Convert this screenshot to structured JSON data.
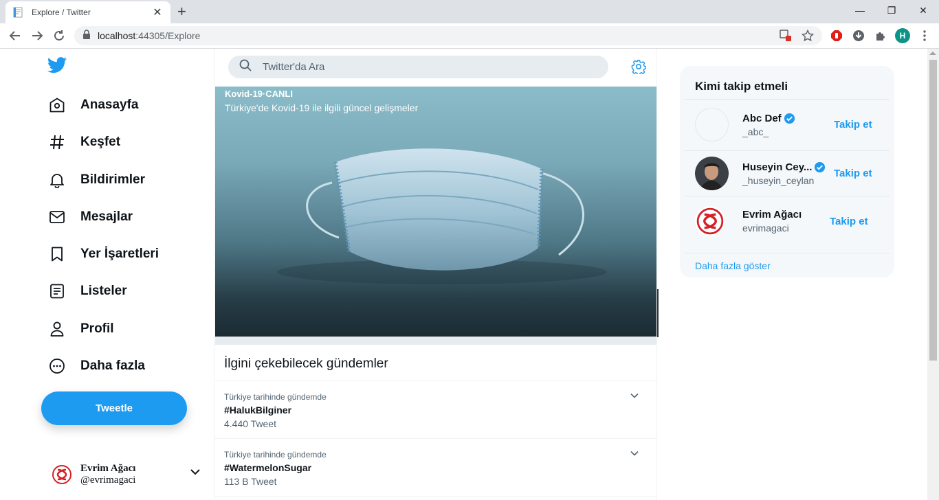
{
  "browser": {
    "tab_title": "Explore / Twitter",
    "url_host": "localhost",
    "url_port_path": ":44305/Explore",
    "profile_initial": "H"
  },
  "nav": {
    "items": [
      {
        "label": "Anasayfa",
        "icon": "home-icon"
      },
      {
        "label": "Keşfet",
        "icon": "hashtag-icon"
      },
      {
        "label": "Bildirimler",
        "icon": "bell-icon"
      },
      {
        "label": "Mesajlar",
        "icon": "mail-icon"
      },
      {
        "label": "Yer İşaretleri",
        "icon": "bookmark-icon"
      },
      {
        "label": "Listeler",
        "icon": "list-icon"
      },
      {
        "label": "Profil",
        "icon": "user-icon"
      },
      {
        "label": "Daha fazla",
        "icon": "more-icon"
      }
    ],
    "tweet_button": "Tweetle",
    "account": {
      "name": "Evrim Ağacı",
      "handle": "@evrimagaci"
    }
  },
  "search": {
    "placeholder": "Twitter'da Ara"
  },
  "hero": {
    "kicker": "Kovid-19·CANLI",
    "title": "Türkiye'de Kovid-19 ile ilgili güncel gelişmeler"
  },
  "trends": {
    "title": "İlgini çekebilecek gündemler",
    "items": [
      {
        "meta": "Türkiye tarihinde gündemde",
        "name": "#HalukBilginer",
        "count": "4.440 Tweet"
      },
      {
        "meta": "Türkiye tarihinde gündemde",
        "name": "#WatermelonSugar",
        "count": "113 B Tweet"
      }
    ]
  },
  "who_to_follow": {
    "title": "Kimi takip etmeli",
    "users": [
      {
        "name": "Abc Def",
        "handle": "_abc_",
        "verified": true,
        "follow": "Takip et"
      },
      {
        "name": "Huseyin Cey...",
        "handle": "_huseyin_ceylan",
        "verified": true,
        "follow": "Takip et"
      },
      {
        "name": "Evrim Ağacı",
        "handle": "evrimagaci",
        "verified": false,
        "follow": "Takip et"
      }
    ],
    "show_more": "Daha fazla göster"
  },
  "colors": {
    "accent": "#1d9bf0",
    "text": "#0f1419",
    "muted": "#536471"
  }
}
